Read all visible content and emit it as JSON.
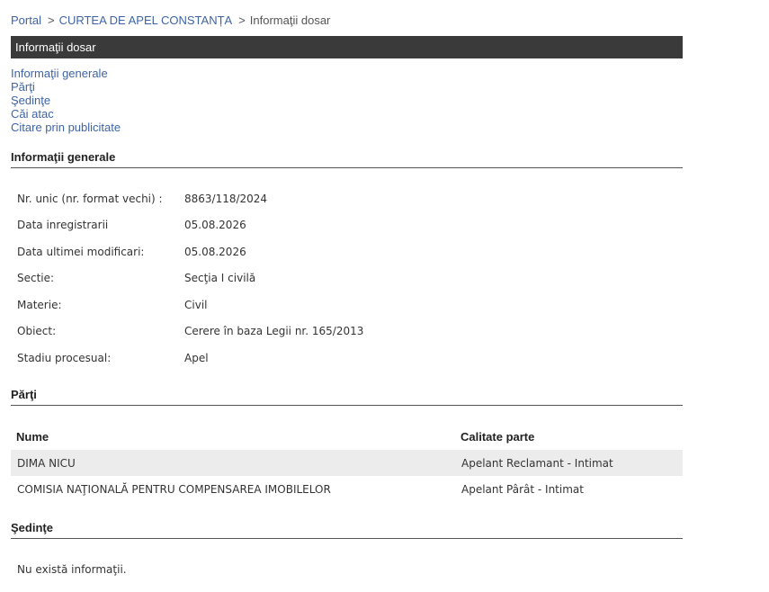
{
  "breadcrumb": {
    "portal": "Portal",
    "separator": ">",
    "court": "CURTEA DE APEL CONSTANȚA",
    "current": "Informaţii dosar"
  },
  "title_bar": "Informaţii dosar",
  "anchors": [
    "Informaţii generale",
    "Părţi",
    "Şedinţe",
    "Căi atac",
    "Citare prin publicitate"
  ],
  "sections": {
    "general": "Informaţii generale",
    "parti": "Părţi",
    "sedinte": "Şedinţe"
  },
  "general_info": [
    {
      "label": "Nr. unic (nr. format vechi) :",
      "value": "8863/118/2024"
    },
    {
      "label": "Data inregistrarii",
      "value": "05.08.2026"
    },
    {
      "label": "Data ultimei modificari:",
      "value": "05.08.2026"
    },
    {
      "label": "Sectie:",
      "value": "Secţia I civilă"
    },
    {
      "label": "Materie:",
      "value": "Civil"
    },
    {
      "label": "Obiect:",
      "value": "Cerere în baza Legii nr. 165/2013"
    },
    {
      "label": "Stadiu procesual:",
      "value": "Apel"
    }
  ],
  "parti": {
    "headers": {
      "nume": "Nume",
      "calitate": "Calitate parte"
    },
    "rows": [
      {
        "nume": "DIMA NICU",
        "calitate": "Apelant Reclamant - Intimat"
      },
      {
        "nume": "COMISIA NAŢIONALĂ PENTRU COMPENSAREA IMOBILELOR",
        "calitate": "Apelant Pârât - Intimat"
      }
    ]
  },
  "sedinte_empty": "Nu există informaţii.",
  "colors": {
    "link": "#3e64a6",
    "title_bar_bg": "#3a3a3a",
    "row_alt": "#ececec"
  }
}
